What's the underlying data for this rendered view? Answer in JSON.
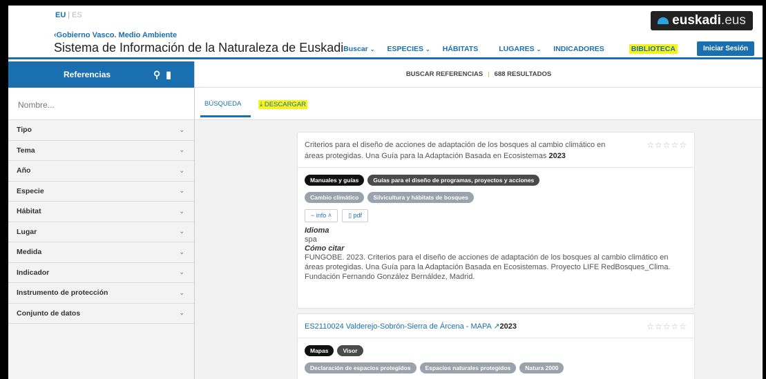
{
  "header": {
    "lang_eu": "EU",
    "lang_es": "ES",
    "back_link": "Gobierno Vasco. Medio Ambiente",
    "site_title": "Sistema de Información de la Naturaleza de Euskadi",
    "logo_text": "euskadi",
    "logo_suffix": ".eus",
    "nav": {
      "buscar": "Buscar",
      "especies": "ESPECIES",
      "habitats": "HÁBITATS",
      "lugares": "LUGARES",
      "indicadores": "INDICADORES",
      "biblioteca": "BIBLIOTECA",
      "login": "Iniciar Sesión"
    }
  },
  "sidebar": {
    "title": "Referencias",
    "search_placeholder": "Nombre...",
    "filters": [
      "Tipo",
      "Tema",
      "Año",
      "Especie",
      "Hábitat",
      "Lugar",
      "Medida",
      "Indicador",
      "Instrumento de protección",
      "Conjunto de datos"
    ]
  },
  "results": {
    "label": "BUSCAR REFERENCIAS",
    "count": "688 RESULTADOS"
  },
  "tabs": {
    "busqueda": "BÚSQUEDA",
    "descargar": "DESCARGAR"
  },
  "cards": [
    {
      "title": "Criterios para el diseño de acciones de adaptación de los bosques al cambio climático en áreas protegidas. Una Guía para la Adaptación Basada en Ecosistemas",
      "year": "2023",
      "stars": "☆☆☆☆☆",
      "chips_row1": [
        "Manuales y guías",
        "Guías para el diseño de programas, proyectos y acciones"
      ],
      "chips_row2": [
        "Cambio climático",
        "Silvicultura y hábitats de bosques"
      ],
      "info_btn": "info",
      "pdf_btn": "pdf",
      "idioma_label": "Idioma",
      "idioma_value": "spa",
      "citar_label": "Cómo citar",
      "citar_value": "FUNGOBE. 2023. Criterios para el diseño de acciones de adaptación de los bosques al cambio climático en áreas protegidas. Una Guía para la Adaptación Basada en Ecosistemas. Proyecto LIFE RedBosques_Clima. Fundación Fernando González Bernáldez, Madrid."
    },
    {
      "title": "ES2110024 Valderejo-Sobrón-Sierra de Árcena - MAPA",
      "year": "2023",
      "stars": "☆☆☆☆☆",
      "chips_row1": [
        "Mapas",
        "Visor"
      ],
      "chips_row2": [
        "Declaración de espacios protegidos",
        "Espacios naturales protegidos",
        "Natura 2000"
      ]
    }
  ]
}
